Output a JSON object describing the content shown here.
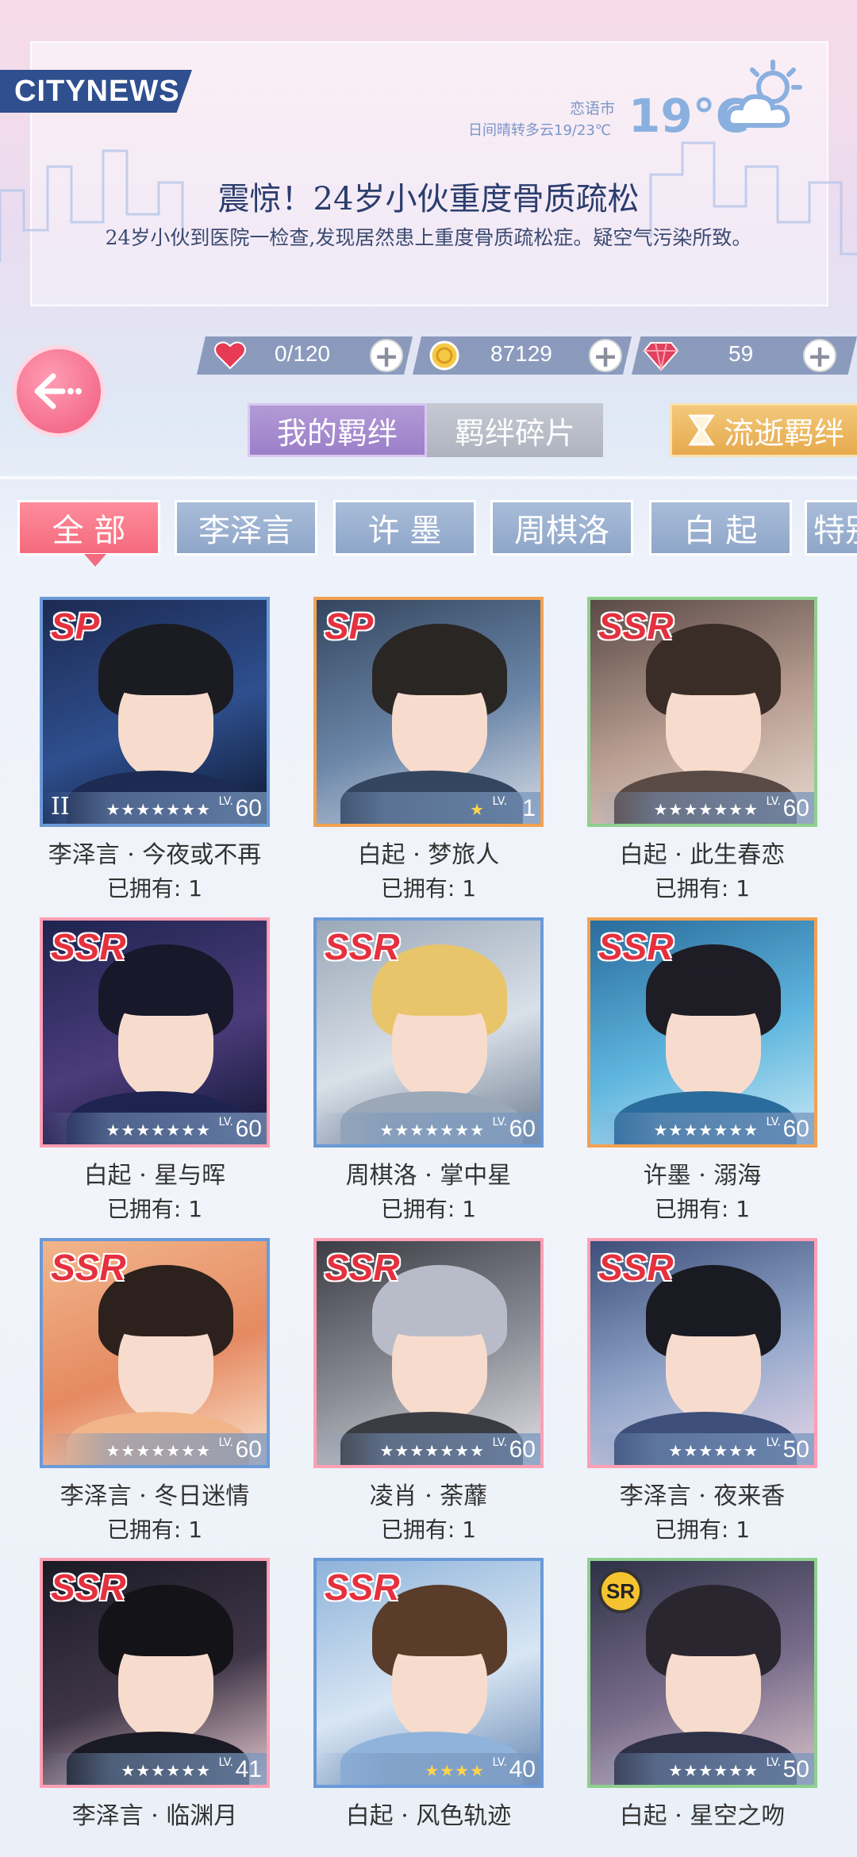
{
  "news": {
    "brand": "CITYNEWS",
    "city": "恋语市",
    "weather_desc": "日间晴转多云19/23℃",
    "temperature": "19°C",
    "headline": "震惊！24岁小伙重度骨质疏松",
    "subline": "24岁小伙到医院一检查,发现居然患上重度骨质疏松症。疑空气污染所致。"
  },
  "currency": {
    "stamina": "0/120",
    "coins": "87129",
    "diamonds": "59"
  },
  "top_tabs": {
    "my_bonds": "我的羁绊",
    "fragments": "羁绊碎片",
    "flow": "流逝羁绊"
  },
  "filters": [
    "全 部",
    "李泽言",
    "许 墨",
    "周棋洛",
    "白 起",
    "特别"
  ],
  "cards": [
    {
      "rarity": "SP",
      "name": "李泽言 · 今夜或不再",
      "owned": "已拥有: 1",
      "lv_label": "LV.",
      "level": "60",
      "stars": "★★★★★★★",
      "rank": "II",
      "frame": "blue"
    },
    {
      "rarity": "SP",
      "name": "白起 · 梦旅人",
      "owned": "已拥有: 1",
      "lv_label": "LV.",
      "level": "1",
      "stars": "★",
      "rank": "",
      "frame": "orange"
    },
    {
      "rarity": "SSR",
      "name": "白起 · 此生春恋",
      "owned": "已拥有: 1",
      "lv_label": "LV.",
      "level": "60",
      "stars": "★★★★★★★",
      "rank": "",
      "frame": "green"
    },
    {
      "rarity": "SSR",
      "name": "白起 · 星与晖",
      "owned": "已拥有: 1",
      "lv_label": "LV.",
      "level": "60",
      "stars": "★★★★★★★",
      "rank": "",
      "frame": "pink"
    },
    {
      "rarity": "SSR",
      "name": "周棋洛 · 掌中星",
      "owned": "已拥有: 1",
      "lv_label": "LV.",
      "level": "60",
      "stars": "★★★★★★★",
      "rank": "",
      "frame": "blue"
    },
    {
      "rarity": "SSR",
      "name": "许墨 · 溺海",
      "owned": "已拥有: 1",
      "lv_label": "LV.",
      "level": "60",
      "stars": "★★★★★★★",
      "rank": "",
      "frame": "orange"
    },
    {
      "rarity": "SSR",
      "name": "李泽言 · 冬日迷情",
      "owned": "已拥有: 1",
      "lv_label": "LV.",
      "level": "60",
      "stars": "★★★★★★★",
      "rank": "",
      "frame": "blue"
    },
    {
      "rarity": "SSR",
      "name": "凌肖 · 荼蘼",
      "owned": "已拥有: 1",
      "lv_label": "LV.",
      "level": "60",
      "stars": "★★★★★★★",
      "rank": "",
      "frame": "pink"
    },
    {
      "rarity": "SSR",
      "name": "李泽言 · 夜来香",
      "owned": "已拥有: 1",
      "lv_label": "LV.",
      "level": "50",
      "stars": "★★★★★★",
      "rank": "",
      "frame": "pink"
    },
    {
      "rarity": "SSR",
      "name": "李泽言 · 临渊月",
      "owned": "",
      "lv_label": "LV.",
      "level": "41",
      "stars": "★★★★★★",
      "rank": "",
      "frame": "pink"
    },
    {
      "rarity": "SSR",
      "name": "白起 · 风色轨迹",
      "owned": "",
      "lv_label": "LV.",
      "level": "40",
      "stars": "★★★★",
      "rank": "",
      "frame": "blue"
    },
    {
      "rarity": "SR",
      "name": "白起 · 星空之吻",
      "owned": "",
      "lv_label": "LV.",
      "level": "50",
      "stars": "★★★★★★",
      "rank": "",
      "frame": "green"
    }
  ],
  "colors": {
    "accent_pink": "#f46a7e",
    "chip_blue": "#8fa6c9",
    "tab_purple": "#9b7fc9",
    "tab_gold": "#e6a94d"
  }
}
